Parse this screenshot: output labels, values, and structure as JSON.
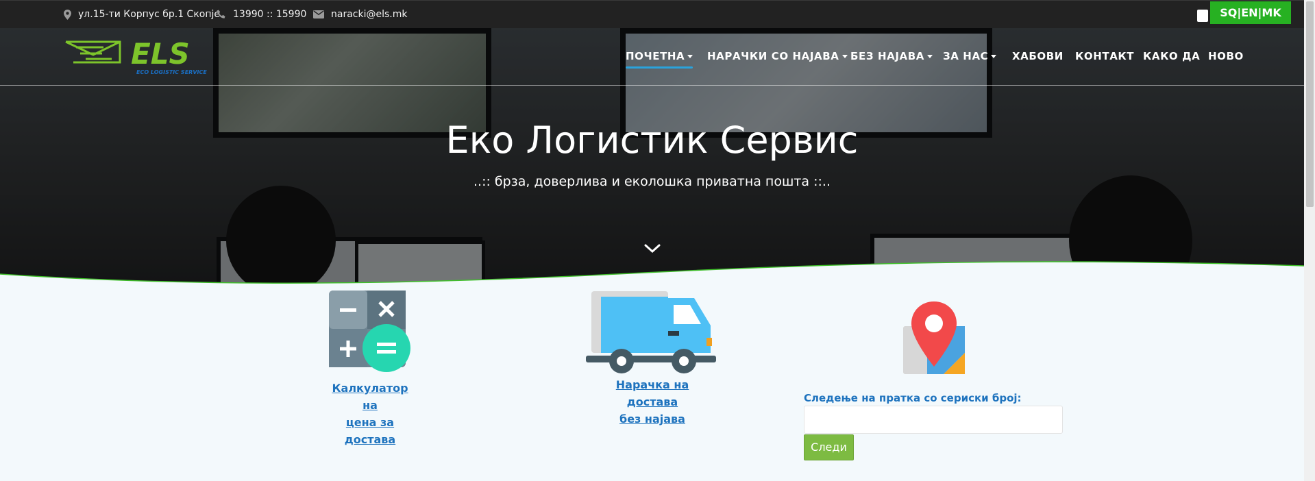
{
  "topbar": {
    "address": "ул.15-ти Корпус бр.1 Скопје",
    "phone": "13990 :: 15990",
    "email": "naracki@els.mk",
    "language_switch": "SQ|EN|MK"
  },
  "logo": {
    "brand": "ELS",
    "tagline": "ECO LOGISTIC SERVICE",
    "colors": {
      "green": "#7dc42b",
      "blue": "#1a6fc4"
    }
  },
  "nav": {
    "items": [
      {
        "label": "ПОЧЕТНА",
        "dropdown": true,
        "active": true
      },
      {
        "label": "НАРАЧКИ СО НАЈАВА",
        "dropdown": true,
        "active": false
      },
      {
        "label": "БЕЗ НАЈАВА",
        "dropdown": true,
        "active": false
      },
      {
        "label": "ЗА НАС",
        "dropdown": true,
        "active": false
      },
      {
        "label": "ХАБОВИ",
        "dropdown": false,
        "active": false
      },
      {
        "label": "КОНТАКТ",
        "dropdown": false,
        "active": false
      },
      {
        "label": "КАКО ДА",
        "dropdown": false,
        "active": false
      },
      {
        "label": "НОВО",
        "dropdown": false,
        "active": false
      }
    ]
  },
  "hero": {
    "title": "Еко Логистик Сервис",
    "subtitle": "..:: брза, доверлива и еколошка приватна пошта ::.."
  },
  "features": {
    "calculator": {
      "icon": "calculator-icon",
      "line1": "Калкулатор на",
      "line2": "цена за",
      "line3": "достава"
    },
    "delivery": {
      "icon": "delivery-truck-icon",
      "line1": "Нарачка на достава",
      "line2": "без најава"
    },
    "tracking": {
      "icon": "map-pin-icon",
      "label": "Следење на пратка со сериски број:",
      "input_value": "",
      "button": "Следи"
    }
  },
  "colors": {
    "topbar": "#222222",
    "lang_button": "#27b122",
    "link": "#1e73be",
    "track_button": "#7dbb42",
    "active_underline": "#2aa3dc",
    "content_bg": "#f3f9fc"
  }
}
